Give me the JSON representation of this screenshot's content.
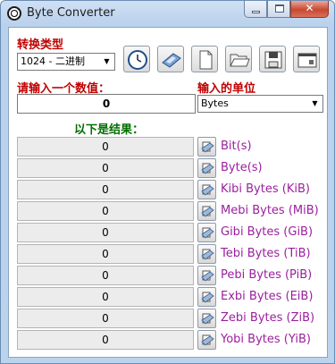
{
  "window": {
    "title": "Byte Converter"
  },
  "labels": {
    "conversion_type": "转换类型",
    "enter_value": "请输入一个数值：",
    "input_unit": "输入的单位",
    "results_heading": "以下是结果："
  },
  "conversion_type": {
    "selected": "1024 - 二进制"
  },
  "input": {
    "value": "0"
  },
  "input_unit": {
    "selected": "Bytes"
  },
  "toolbar": [
    {
      "icon": "clock-icon"
    },
    {
      "icon": "calculator-icon"
    },
    {
      "icon": "new-document-icon"
    },
    {
      "icon": "open-folder-icon"
    },
    {
      "icon": "save-icon"
    },
    {
      "icon": "window-icon"
    }
  ],
  "results": [
    {
      "value": "0",
      "unit": "Bit(s)"
    },
    {
      "value": "0",
      "unit": "Byte(s)"
    },
    {
      "value": "0",
      "unit": "Kibi Bytes (KiB)"
    },
    {
      "value": "0",
      "unit": "Mebi Bytes (MiB)"
    },
    {
      "value": "0",
      "unit": "Gibi Bytes (GiB)"
    },
    {
      "value": "0",
      "unit": "Tebi Bytes (TiB)"
    },
    {
      "value": "0",
      "unit": "Pebi Bytes (PiB)"
    },
    {
      "value": "0",
      "unit": "Exbi Bytes (EiB)"
    },
    {
      "value": "0",
      "unit": "Zebi Bytes (ZiB)"
    },
    {
      "value": "0",
      "unit": "Yobi Bytes (YiB)"
    }
  ],
  "colors": {
    "label_red": "#c00000",
    "label_green": "#006e00",
    "unit_purple": "#9b1f9e"
  }
}
